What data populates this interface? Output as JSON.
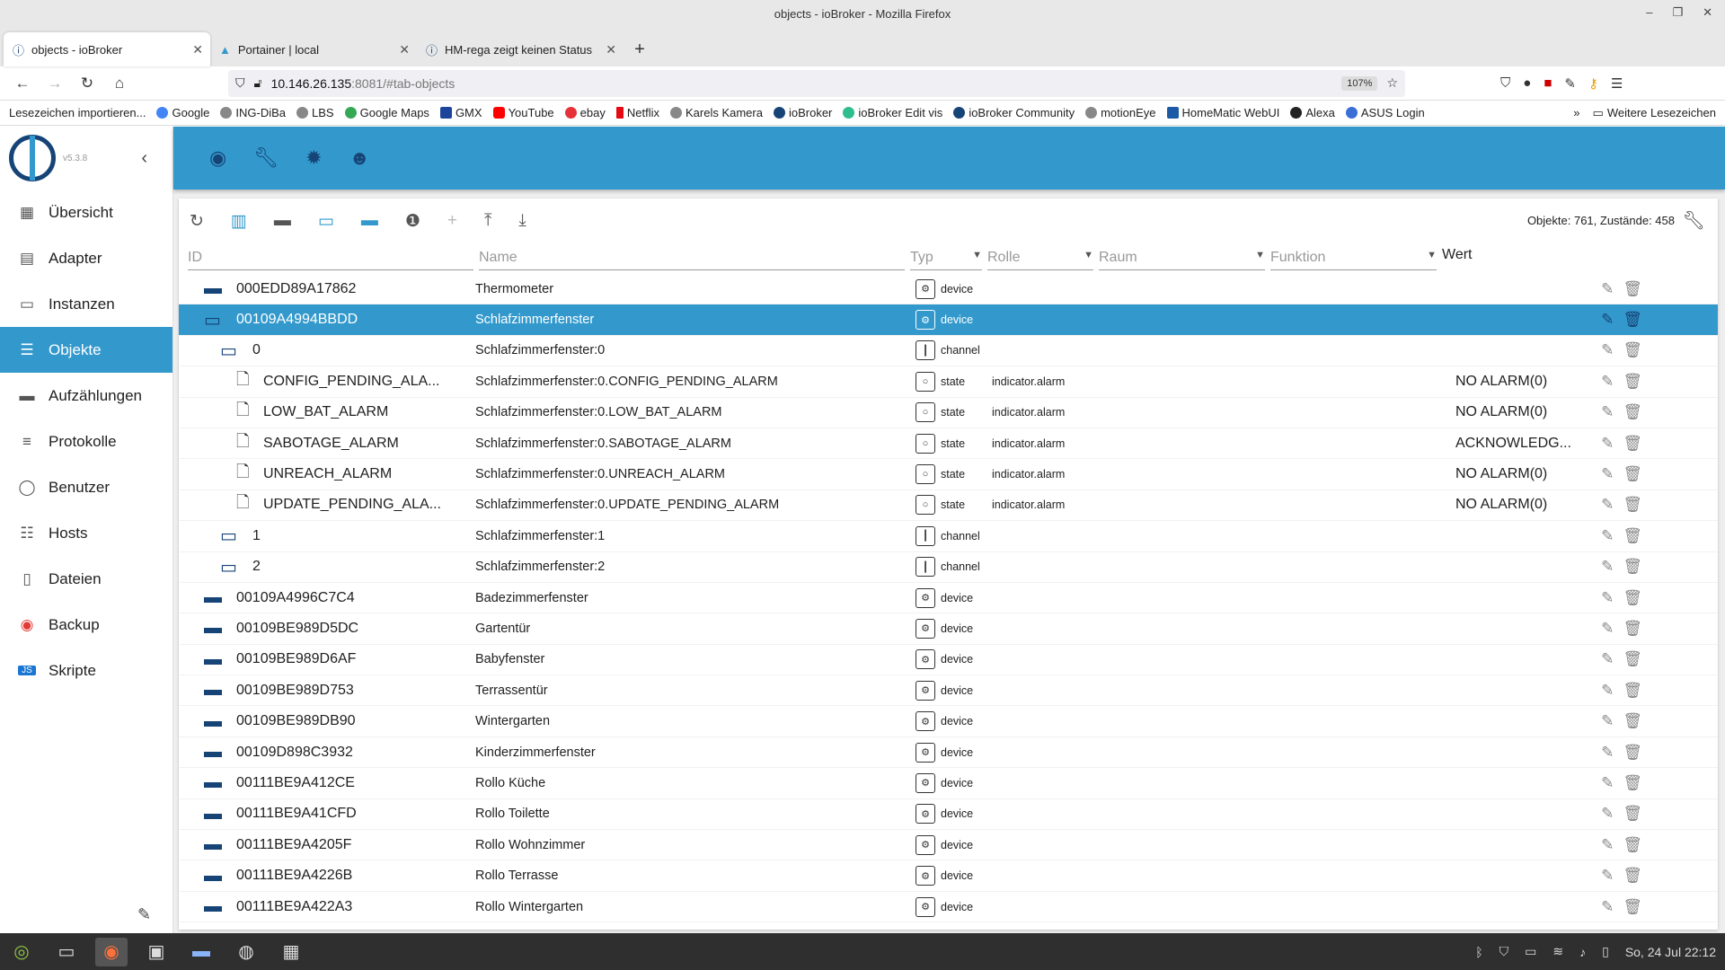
{
  "window": {
    "title": "objects - ioBroker - Mozilla Firefox"
  },
  "tabs": [
    {
      "label": "objects - ioBroker",
      "active": true
    },
    {
      "label": "Portainer | local",
      "active": false
    },
    {
      "label": "HM-rega zeigt keinen Status",
      "active": false
    }
  ],
  "url": {
    "host": "10.146.26.135",
    "path": ":8081/#tab-objects",
    "zoom": "107%"
  },
  "bookmarks": [
    "Lesezeichen importieren...",
    "Google",
    "ING-DiBa",
    "LBS",
    "Google Maps",
    "GMX",
    "YouTube",
    "ebay",
    "Netflix",
    "Karels Kamera",
    "ioBroker",
    "ioBroker Edit vis",
    "ioBroker Community",
    "motionEye",
    "HomeMatic WebUI",
    "Alexa",
    "ASUS Login"
  ],
  "bookmarks_more": "Weitere Lesezeichen",
  "sidebar": {
    "version": "v5.3.8",
    "items": [
      {
        "label": "Übersicht",
        "icon": "grid-icon",
        "glyph": "▦"
      },
      {
        "label": "Adapter",
        "icon": "store-icon",
        "glyph": "▤"
      },
      {
        "label": "Instanzen",
        "icon": "instances-icon",
        "glyph": "▭"
      },
      {
        "label": "Objekte",
        "icon": "list-icon",
        "glyph": "☰",
        "active": true
      },
      {
        "label": "Aufzählungen",
        "icon": "enum-icon",
        "glyph": "▬"
      },
      {
        "label": "Protokolle",
        "icon": "log-icon",
        "glyph": "≡"
      },
      {
        "label": "Benutzer",
        "icon": "user-icon",
        "glyph": "◯"
      },
      {
        "label": "Hosts",
        "icon": "hosts-icon",
        "glyph": "☷"
      },
      {
        "label": "Dateien",
        "icon": "file-icon",
        "glyph": "▯"
      },
      {
        "label": "Backup",
        "icon": "backup-icon",
        "glyph": "◉"
      },
      {
        "label": "Skripte",
        "icon": "js-icon",
        "glyph": "JS"
      }
    ]
  },
  "toolbar": {
    "counts": "Objekte: 761, Zustände: 458"
  },
  "columns": {
    "id": "ID",
    "name": "Name",
    "typ": "Typ",
    "rolle": "Rolle",
    "raum": "Raum",
    "funktion": "Funktion",
    "wert": "Wert"
  },
  "rows": [
    {
      "indent": 0,
      "kind": "folder-closed",
      "id": "000EDD89A17862",
      "name": "Thermometer",
      "type": "device",
      "role": "",
      "value": ""
    },
    {
      "indent": 0,
      "kind": "folder-open",
      "id": "00109A4994BBDD",
      "name": "Schlafzimmerfenster",
      "type": "device",
      "role": "",
      "value": "",
      "selected": true
    },
    {
      "indent": 1,
      "kind": "folder-open",
      "id": "0",
      "name": "Schlafzimmerfenster:0",
      "type": "channel",
      "role": "",
      "value": ""
    },
    {
      "indent": 2,
      "kind": "file",
      "id": "CONFIG_PENDING_ALA...",
      "name": "Schlafzimmerfenster:0.CONFIG_PENDING_ALARM",
      "type": "state",
      "role": "indicator.alarm",
      "value": "NO ALARM(0)"
    },
    {
      "indent": 2,
      "kind": "file",
      "id": "LOW_BAT_ALARM",
      "name": "Schlafzimmerfenster:0.LOW_BAT_ALARM",
      "type": "state",
      "role": "indicator.alarm",
      "value": "NO ALARM(0)"
    },
    {
      "indent": 2,
      "kind": "file",
      "id": "SABOTAGE_ALARM",
      "name": "Schlafzimmerfenster:0.SABOTAGE_ALARM",
      "type": "state",
      "role": "indicator.alarm",
      "value": "ACKNOWLEDG..."
    },
    {
      "indent": 2,
      "kind": "file",
      "id": "UNREACH_ALARM",
      "name": "Schlafzimmerfenster:0.UNREACH_ALARM",
      "type": "state",
      "role": "indicator.alarm",
      "value": "NO ALARM(0)"
    },
    {
      "indent": 2,
      "kind": "file",
      "id": "UPDATE_PENDING_ALA...",
      "name": "Schlafzimmerfenster:0.UPDATE_PENDING_ALARM",
      "type": "state",
      "role": "indicator.alarm",
      "value": "NO ALARM(0)"
    },
    {
      "indent": 1,
      "kind": "folder-open",
      "id": "1",
      "name": "Schlafzimmerfenster:1",
      "type": "channel",
      "role": "",
      "value": ""
    },
    {
      "indent": 1,
      "kind": "folder-open",
      "id": "2",
      "name": "Schlafzimmerfenster:2",
      "type": "channel",
      "role": "",
      "value": ""
    },
    {
      "indent": 0,
      "kind": "folder-closed",
      "id": "00109A4996C7C4",
      "name": "Badezimmerfenster",
      "type": "device",
      "role": "",
      "value": ""
    },
    {
      "indent": 0,
      "kind": "folder-closed",
      "id": "00109BE989D5DC",
      "name": "Gartentür",
      "type": "device",
      "role": "",
      "value": ""
    },
    {
      "indent": 0,
      "kind": "folder-closed",
      "id": "00109BE989D6AF",
      "name": "Babyfenster",
      "type": "device",
      "role": "",
      "value": ""
    },
    {
      "indent": 0,
      "kind": "folder-closed",
      "id": "00109BE989D753",
      "name": "Terrassentür",
      "type": "device",
      "role": "",
      "value": ""
    },
    {
      "indent": 0,
      "kind": "folder-closed",
      "id": "00109BE989DB90",
      "name": "Wintergarten",
      "type": "device",
      "role": "",
      "value": ""
    },
    {
      "indent": 0,
      "kind": "folder-closed",
      "id": "00109D898C3932",
      "name": "Kinderzimmerfenster",
      "type": "device",
      "role": "",
      "value": ""
    },
    {
      "indent": 0,
      "kind": "folder-closed",
      "id": "00111BE9A412CE",
      "name": "Rollo Küche",
      "type": "device",
      "role": "",
      "value": ""
    },
    {
      "indent": 0,
      "kind": "folder-closed",
      "id": "00111BE9A41CFD",
      "name": "Rollo Toilette",
      "type": "device",
      "role": "",
      "value": ""
    },
    {
      "indent": 0,
      "kind": "folder-closed",
      "id": "00111BE9A4205F",
      "name": "Rollo Wohnzimmer",
      "type": "device",
      "role": "",
      "value": ""
    },
    {
      "indent": 0,
      "kind": "folder-closed",
      "id": "00111BE9A4226B",
      "name": "Rollo Terrasse",
      "type": "device",
      "role": "",
      "value": ""
    },
    {
      "indent": 0,
      "kind": "folder-closed",
      "id": "00111BE9A422A3",
      "name": "Rollo Wintergarten",
      "type": "device",
      "role": "",
      "value": ""
    }
  ],
  "taskbar": {
    "clock": "So, 24 Jul 22:12"
  },
  "colors": {
    "accent": "#3399cc",
    "dark": "#164477"
  }
}
